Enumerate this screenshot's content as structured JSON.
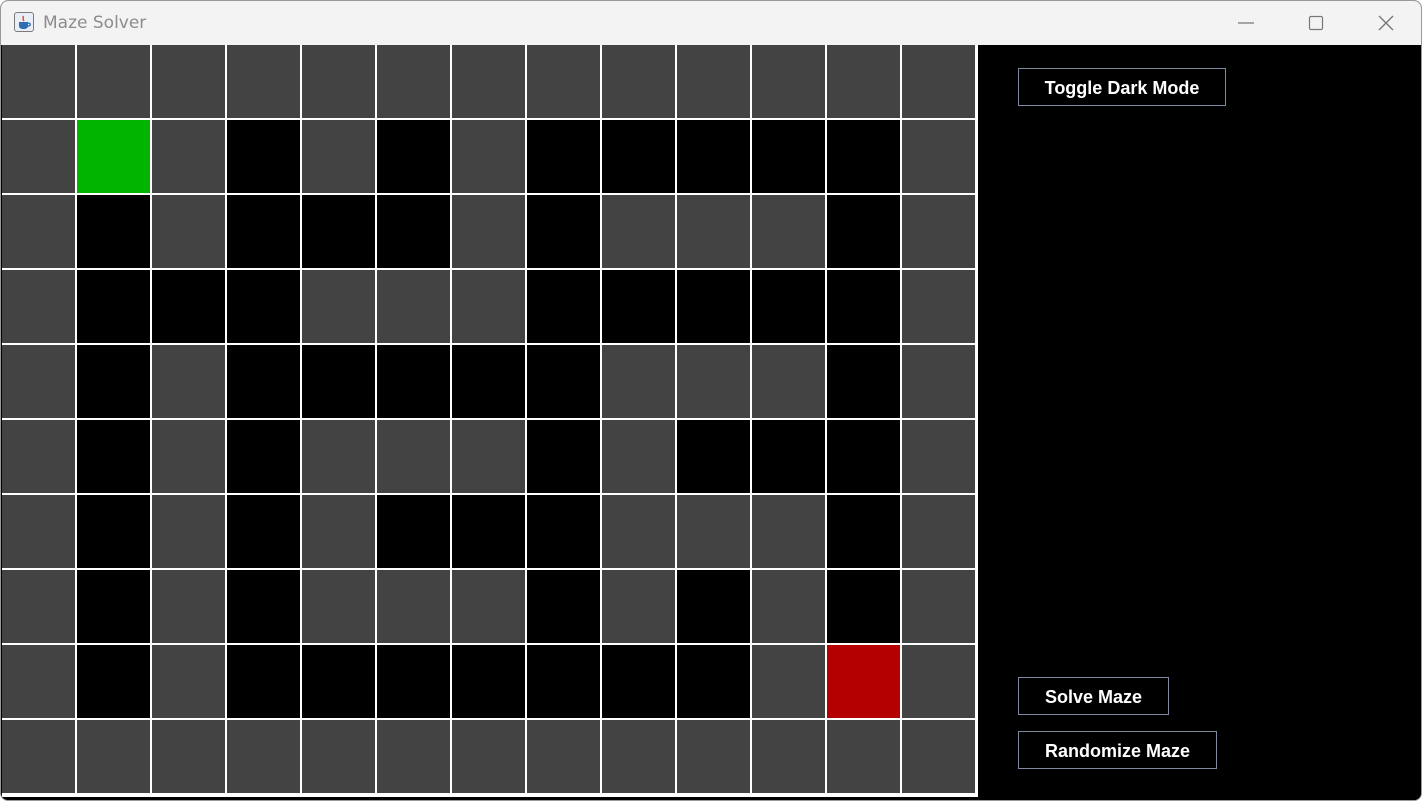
{
  "window": {
    "title": "Maze Solver",
    "icon": "java-cup-icon",
    "controls": [
      "minimize-icon",
      "maximize-icon",
      "close-icon"
    ]
  },
  "maze": {
    "rows": 10,
    "cols": 13,
    "legend": {
      "0": "open",
      "1": "wall",
      "S": "start",
      "E": "end"
    },
    "colors": {
      "open": "#434343",
      "wall": "#000000",
      "start": "#00b400",
      "end": "#b40000",
      "grid_lines": "#ffffff"
    },
    "grid": [
      "0000000000000",
      "0S01010111110",
      "0101110100010",
      "0111000111110",
      "0101111100010",
      "0101000101110",
      "0101011100010",
      "0101000101010",
      "01011111110E0",
      "0000000000000"
    ]
  },
  "panel": {
    "toggle_dark_mode": "Toggle Dark Mode",
    "solve_maze": "Solve Maze",
    "randomize_maze": "Randomize Maze"
  }
}
